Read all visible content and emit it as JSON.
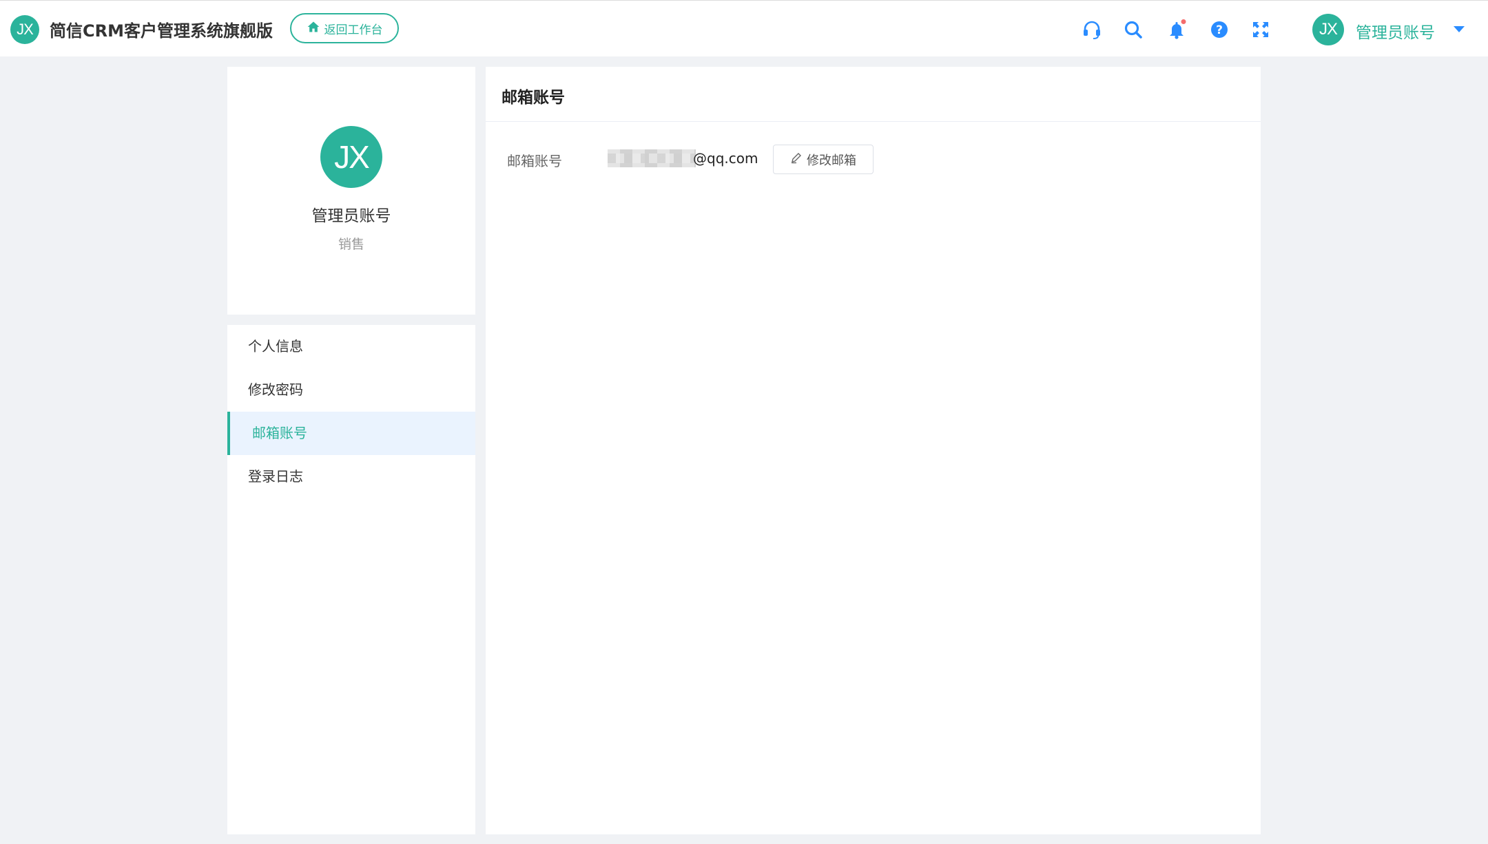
{
  "app": {
    "logo_text": "JX",
    "title": "简信CRM客户管理系统旗舰版",
    "back_button_label": "返回工作台"
  },
  "header_icons": [
    "headset-icon",
    "search-icon",
    "bell-icon",
    "help-icon",
    "fullscreen-icon"
  ],
  "user": {
    "avatar_text": "JX",
    "name": "管理员账号"
  },
  "profile": {
    "avatar_text": "JX",
    "name": "管理员账号",
    "role": "销售"
  },
  "menu": {
    "items": [
      {
        "label": "个人信息"
      },
      {
        "label": "修改密码"
      },
      {
        "label": "邮箱账号"
      },
      {
        "label": "登录日志"
      }
    ],
    "active_index": 2
  },
  "main": {
    "title": "邮箱账号",
    "field_label": "邮箱账号",
    "email_suffix": "@qq.com",
    "edit_button_label": "修改邮箱"
  },
  "colors": {
    "accent": "#2bb39b",
    "icon_blue": "#2a8cff",
    "notification_dot": "#f56c6c",
    "background": "#f0f2f5"
  }
}
